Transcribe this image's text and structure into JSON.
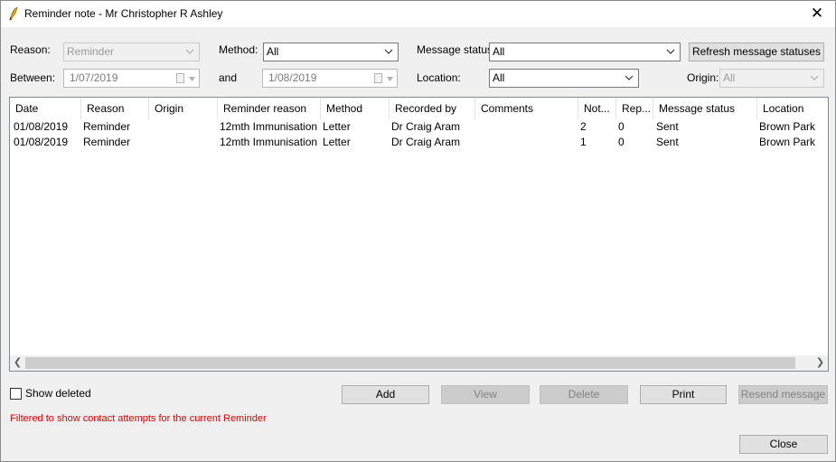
{
  "window": {
    "title": "Reminder note - Mr Christopher R Ashley",
    "close_glyph": "✕"
  },
  "filters": {
    "reason_label": "Reason:",
    "reason_value": "Reminder",
    "method_label": "Method:",
    "method_value": "All",
    "message_status_label": "Message status:",
    "message_status_value": "All",
    "refresh_label": "Refresh message statuses",
    "between_label": "Between:",
    "between_from": "1/07/2019",
    "and_label": "and",
    "between_to": "1/08/2019",
    "location_label": "Location:",
    "location_value": "All",
    "origin_label": "Origin:",
    "origin_value": "All"
  },
  "grid": {
    "columns": [
      "Date",
      "Reason",
      "Origin",
      "Reminder reason",
      "Method",
      "Recorded by",
      "Comments",
      "Not...",
      "Rep...",
      "Message status",
      "Location"
    ],
    "rows": [
      [
        "01/08/2019",
        "Reminder",
        "",
        "12mth Immunisation",
        "Letter",
        "Dr Craig Aram",
        "",
        "2",
        "0",
        "Sent",
        "Brown Park"
      ],
      [
        "01/08/2019",
        "Reminder",
        "",
        "12mth Immunisation",
        "Letter",
        "Dr Craig Aram",
        "",
        "1",
        "0",
        "Sent",
        "Brown Park"
      ]
    ]
  },
  "footer": {
    "show_deleted_label": "Show deleted",
    "show_deleted_checked": false,
    "add_label": "Add",
    "view_label": "View",
    "delete_label": "Delete",
    "print_label": "Print",
    "resend_label": "Resend message",
    "filter_note": "Filtered to show contact attempts for the current Reminder",
    "close_label": "Close"
  },
  "colors": {
    "filter_note": "#e60000",
    "window_bg": "#f0f0f0",
    "button_bg": "#e1e1e1"
  }
}
